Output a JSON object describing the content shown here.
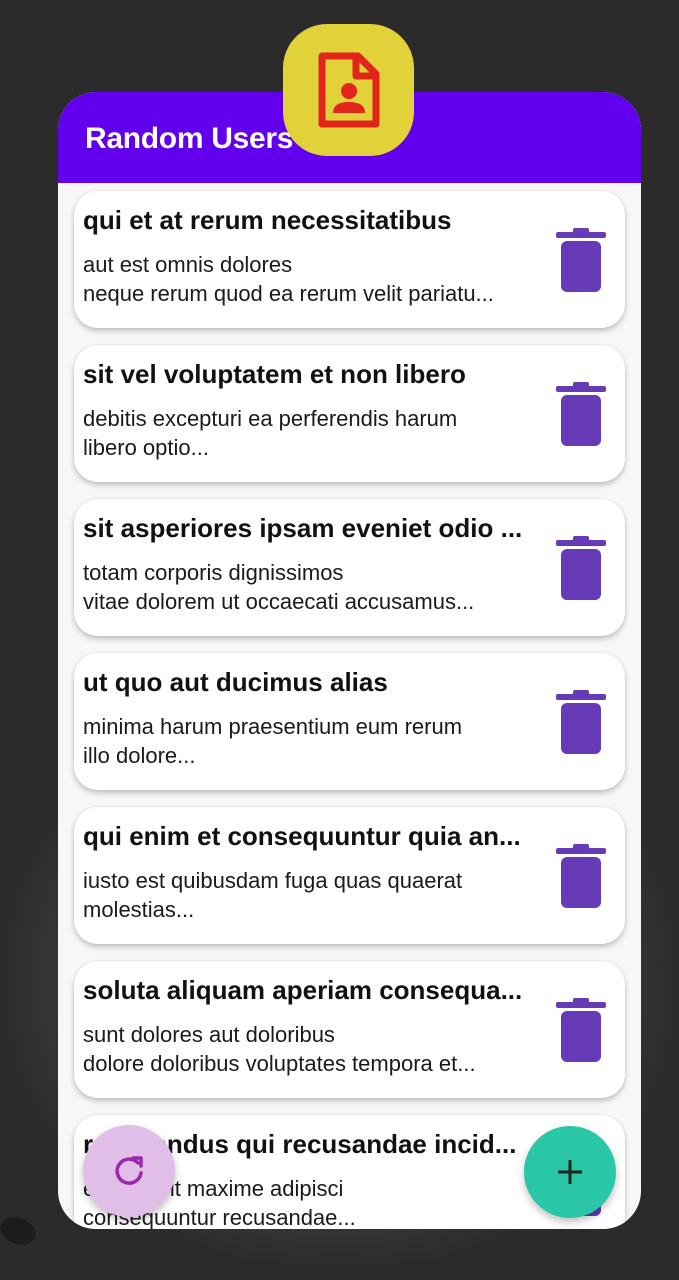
{
  "app": {
    "title": "Random Users",
    "icon": "contact-document-icon"
  },
  "colors": {
    "app_bar": "#6200ee",
    "delete_icon": "#673ab7",
    "refresh_fab": "#e1bee7",
    "add_fab": "#2ac7a7",
    "app_icon_bg": "#e0d238",
    "app_icon_fg": "#e1251b"
  },
  "posts": [
    {
      "title": "qui et at rerum necessitatibus",
      "body": [
        "aut est omnis dolores",
        "neque rerum quod ea rerum velit pariatu..."
      ]
    },
    {
      "title": "sit vel voluptatem et non libero",
      "body": [
        "debitis excepturi ea perferendis harum",
        "libero optio..."
      ]
    },
    {
      "title": "sit asperiores ipsam eveniet odio ...",
      "body": [
        "totam corporis dignissimos",
        "vitae dolorem ut occaecati accusamus..."
      ]
    },
    {
      "title": "ut quo aut ducimus alias",
      "body": [
        "minima harum praesentium eum rerum",
        "illo dolore..."
      ]
    },
    {
      "title": "qui enim et consequuntur quia an...",
      "body": [
        "iusto est quibusdam fuga quas quaerat",
        "molestias..."
      ]
    },
    {
      "title": "soluta aliquam aperiam consequa...",
      "body": [
        "sunt dolores aut doloribus",
        "dolore doloribus voluptates tempora et..."
      ]
    },
    {
      "title": "repellendus qui recusandae incid...",
      "body": [
        "et suscipit maxime adipisci",
        "consequuntur recusandae..."
      ]
    }
  ],
  "fabs": {
    "refresh_icon": "refresh-icon",
    "add_icon": "plus-icon"
  }
}
